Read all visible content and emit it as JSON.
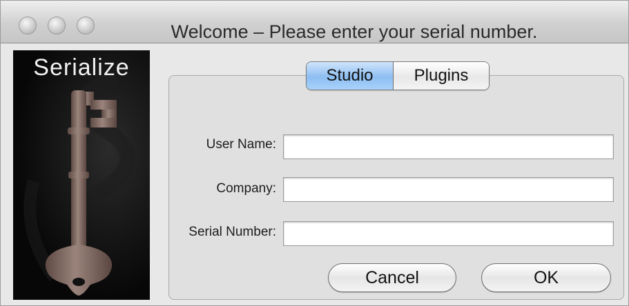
{
  "window": {
    "title": "Welcome – Please enter your serial number."
  },
  "sidebar": {
    "title": "Serialize"
  },
  "tabs": [
    {
      "label": "Studio",
      "selected": true
    },
    {
      "label": "Plugins",
      "selected": false
    }
  ],
  "form": {
    "user_name_label": "User Name:",
    "user_name_value": "",
    "company_label": "Company:",
    "company_value": "",
    "serial_label": "Serial Number:",
    "serial_value": ""
  },
  "buttons": {
    "cancel": "Cancel",
    "ok": "OK"
  },
  "colors": {
    "selected_tab": "#8dbef2",
    "window_bg": "#e8e8e8"
  }
}
